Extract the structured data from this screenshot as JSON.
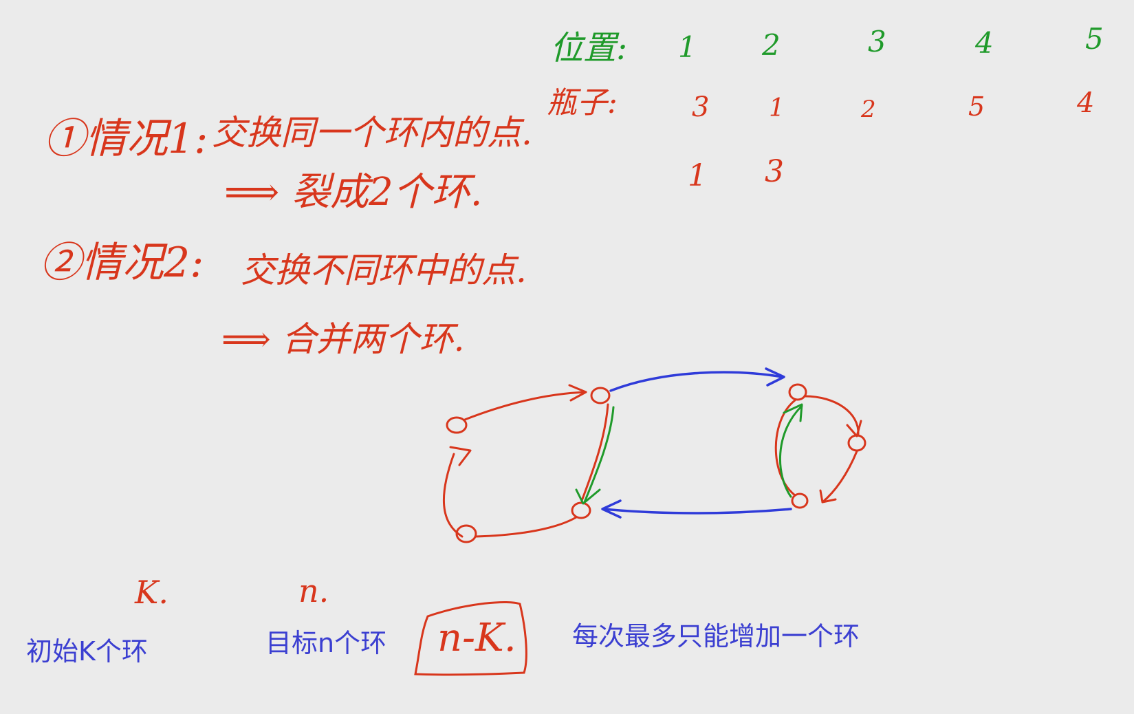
{
  "top_table": {
    "row1_label": "位置:",
    "row1_values": [
      "1",
      "2",
      "3",
      "4",
      "5"
    ],
    "row2_label": "瓶子:",
    "row2_values": [
      "3",
      "1",
      "2",
      "5",
      "4"
    ],
    "row3_values": [
      "1",
      "3"
    ]
  },
  "cases": {
    "case1_label": "①情况1:",
    "case1_text": "交换同一个环内的点.",
    "case1_result": "⟹ 裂成2个环.",
    "case2_label": "②情况2:",
    "case2_text": "交换不同环中的点.",
    "case2_result": "⟹ 合并两个环."
  },
  "bottom": {
    "k_mark": "K.",
    "n_mark": "n.",
    "initial_label": "初始K个环",
    "target_label": "目标n个环",
    "box_text": "n-K.",
    "note": "每次最多只能增加一个环"
  },
  "colors": {
    "red_ink": "#d8361c",
    "green_ink": "#1f9a2a",
    "blue_ink": "#2f3bd9",
    "background": "#ebebeb"
  }
}
